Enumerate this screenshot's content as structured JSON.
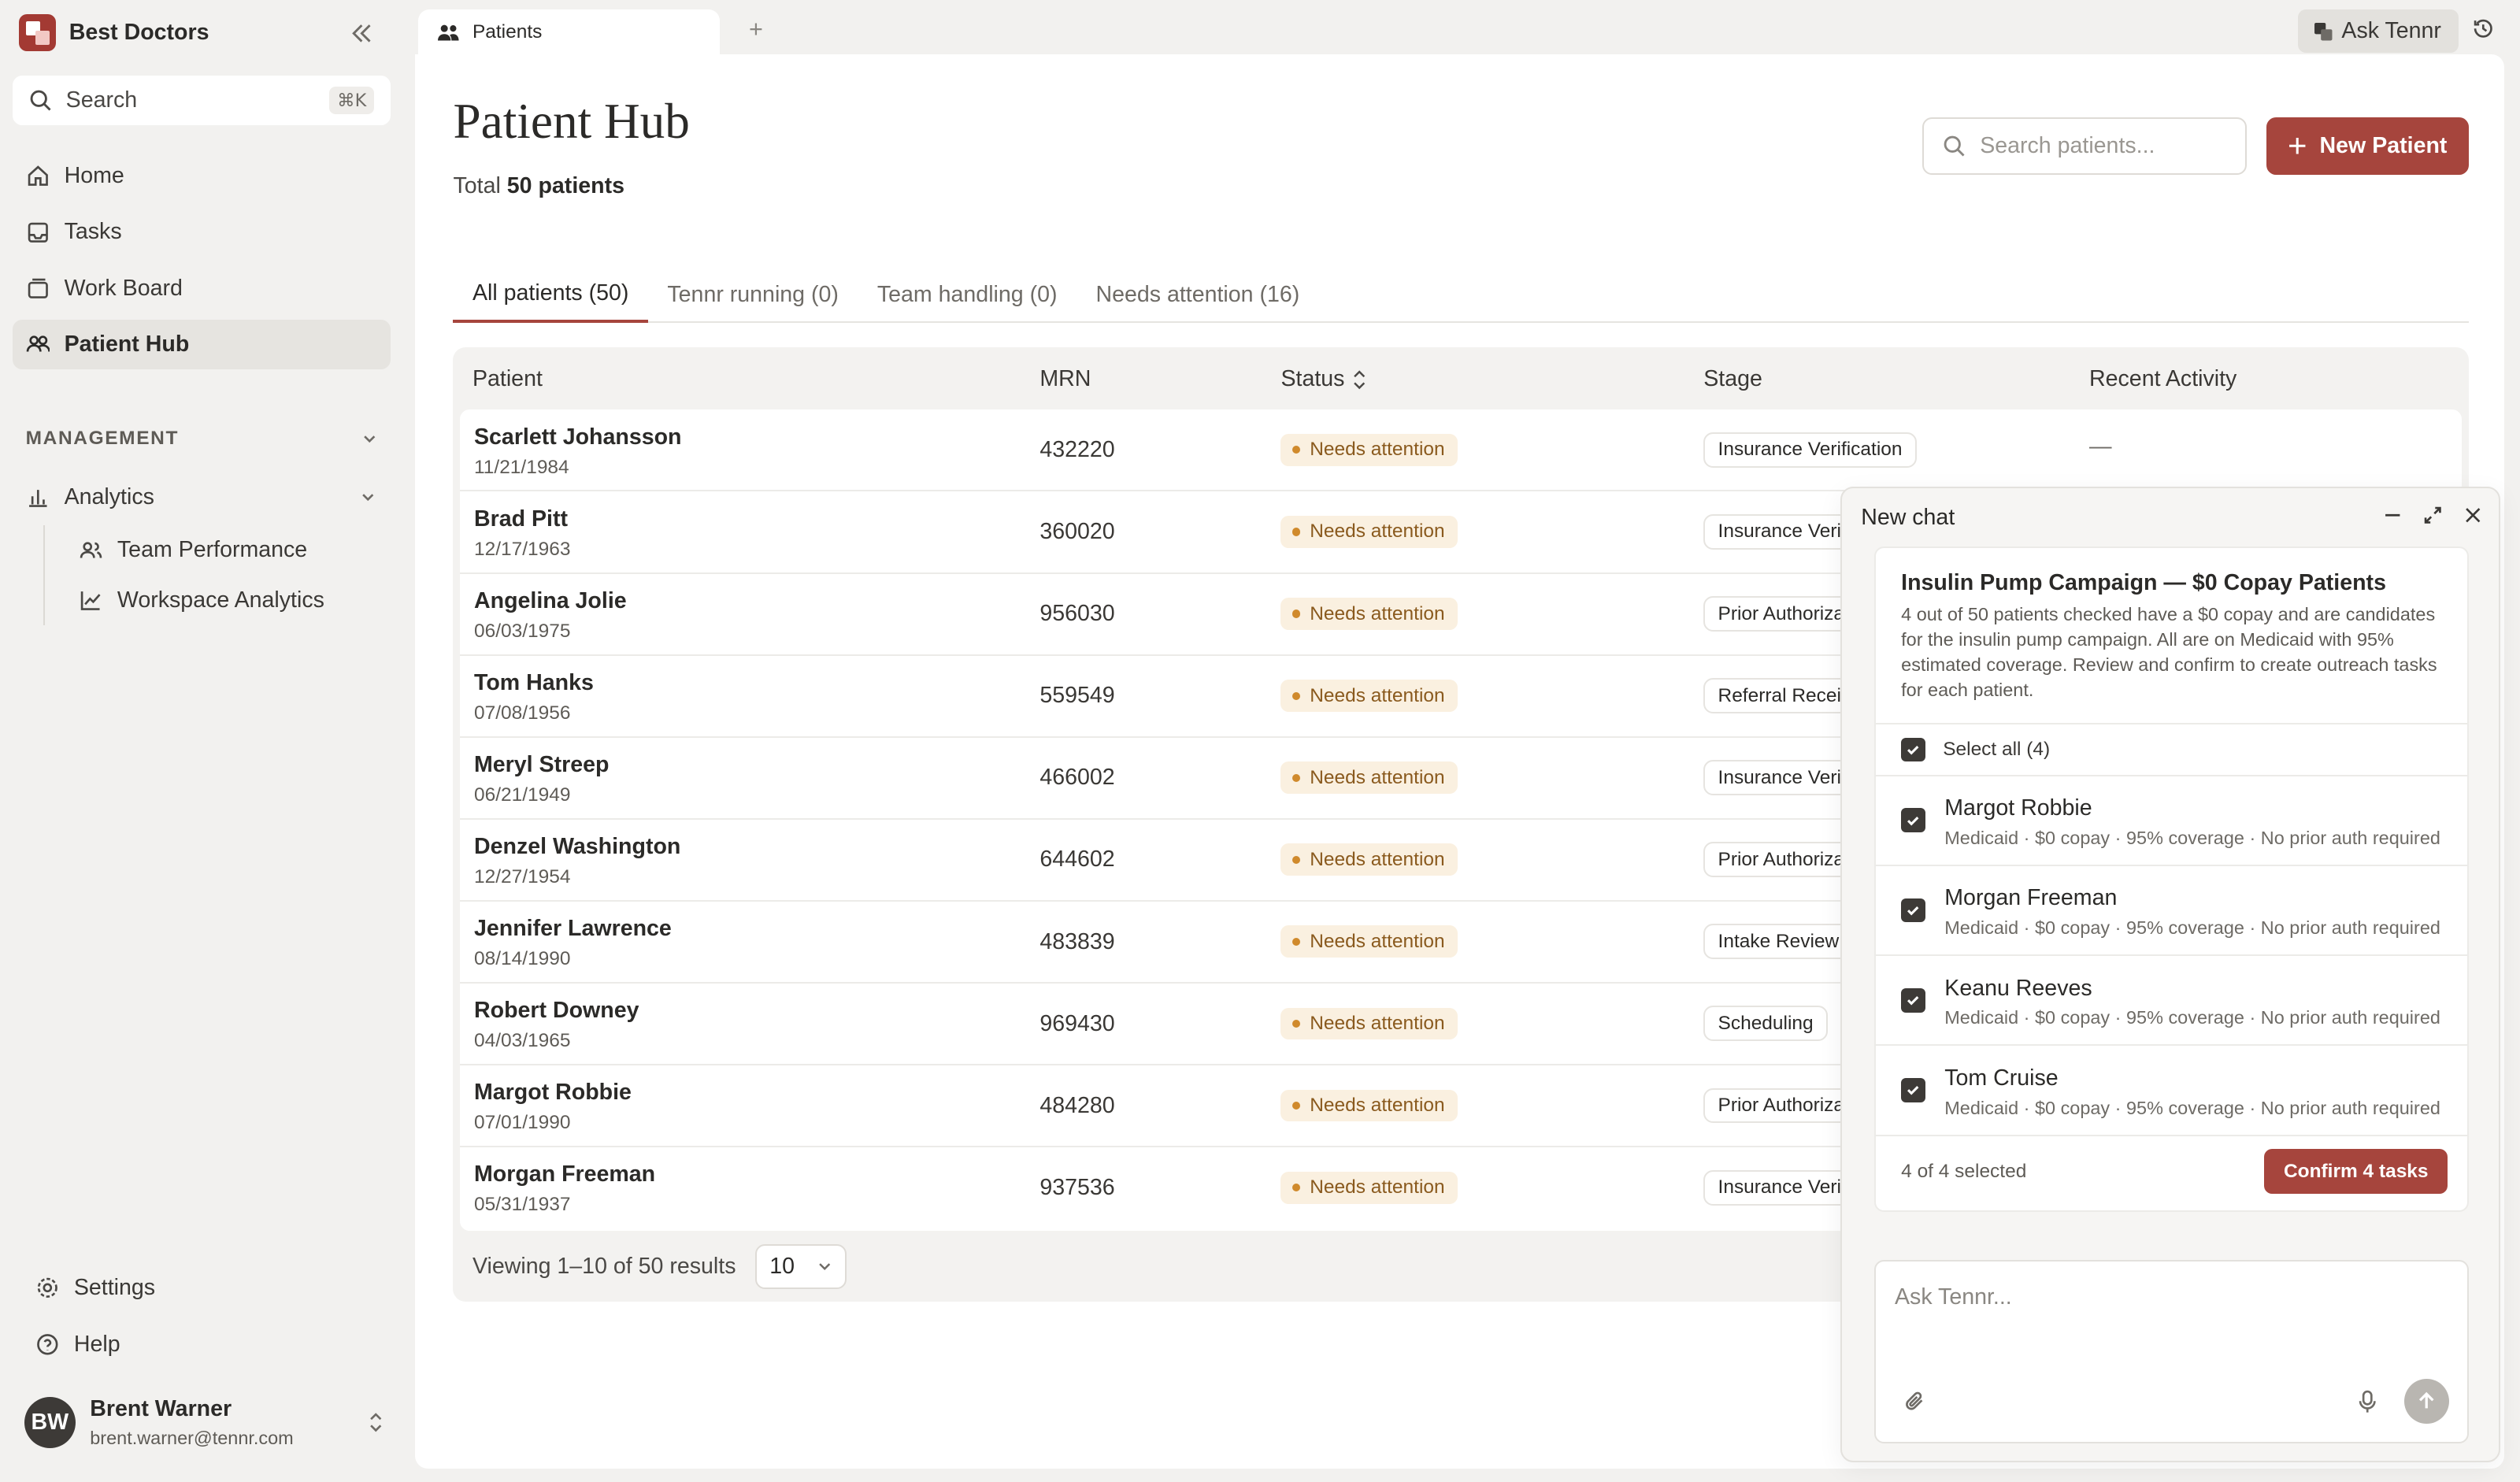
{
  "sidebar": {
    "brand_name": "Best Doctors",
    "search_label": "Search",
    "search_shortcut": "⌘K",
    "nav": [
      {
        "label": "Home"
      },
      {
        "label": "Tasks"
      },
      {
        "label": "Work Board"
      },
      {
        "label": "Patient Hub"
      }
    ],
    "section_label": "MANAGEMENT",
    "analytics_label": "Analytics",
    "analytics_items": [
      {
        "label": "Team Performance"
      },
      {
        "label": "Workspace Analytics"
      }
    ],
    "settings_label": "Settings",
    "help_label": "Help",
    "user": {
      "initials": "BW",
      "name": "Brent Warner",
      "email": "brent.warner@tennr.com"
    }
  },
  "topbar": {
    "tab_label": "Patients",
    "new_tab": "+",
    "ask_label": "Ask Tennr"
  },
  "main": {
    "title": "Patient Hub",
    "total_prefix": "Total",
    "total_value": "50 patients",
    "search_placeholder": "Search patients...",
    "new_patient_label": "New Patient",
    "tabs": [
      {
        "label": "All patients (50)"
      },
      {
        "label": "Tennr running (0)"
      },
      {
        "label": "Team handling (0)"
      },
      {
        "label": "Needs attention (16)"
      }
    ],
    "columns": {
      "patient": "Patient",
      "mrn": "MRN",
      "status": "Status",
      "stage": "Stage",
      "recent": "Recent Activity"
    },
    "rows": [
      {
        "name": "Scarlett Johansson",
        "dob": "11/21/1984",
        "mrn": "432220",
        "status": "Needs attention",
        "stage": "Insurance Verification",
        "recent": "—"
      },
      {
        "name": "Brad Pitt",
        "dob": "12/17/1963",
        "mrn": "360020",
        "status": "Needs attention",
        "stage": "Insurance Verification",
        "recent": ""
      },
      {
        "name": "Angelina Jolie",
        "dob": "06/03/1975",
        "mrn": "956030",
        "status": "Needs attention",
        "stage": "Prior Authorization",
        "recent": ""
      },
      {
        "name": "Tom Hanks",
        "dob": "07/08/1956",
        "mrn": "559549",
        "status": "Needs attention",
        "stage": "Referral Received",
        "recent": ""
      },
      {
        "name": "Meryl Streep",
        "dob": "06/21/1949",
        "mrn": "466002",
        "status": "Needs attention",
        "stage": "Insurance Verification",
        "recent": ""
      },
      {
        "name": "Denzel Washington",
        "dob": "12/27/1954",
        "mrn": "644602",
        "status": "Needs attention",
        "stage": "Prior Authorization",
        "recent": ""
      },
      {
        "name": "Jennifer Lawrence",
        "dob": "08/14/1990",
        "mrn": "483839",
        "status": "Needs attention",
        "stage": "Intake Review",
        "recent": ""
      },
      {
        "name": "Robert Downey",
        "dob": "04/03/1965",
        "mrn": "969430",
        "status": "Needs attention",
        "stage": "Scheduling",
        "recent": ""
      },
      {
        "name": "Margot Robbie",
        "dob": "07/01/1990",
        "mrn": "484280",
        "status": "Needs attention",
        "stage": "Prior Authorization",
        "recent": ""
      },
      {
        "name": "Morgan Freeman",
        "dob": "05/31/1937",
        "mrn": "937536",
        "status": "Needs attention",
        "stage": "Insurance Verification",
        "recent": ""
      }
    ],
    "pagination_text": "Viewing 1–10 of 50 results",
    "page_size": "10"
  },
  "chat": {
    "title": "New chat",
    "card_title": "Insulin Pump Campaign — $0 Copay Patients",
    "card_desc": "4 out of 50 patients checked have a $0 copay and are candidates for the insulin pump campaign. All are on Medicaid with 95% estimated coverage. Review and confirm to create outreach tasks for each patient.",
    "select_all_label": "Select all (4)",
    "patients": [
      {
        "name": "Margot Robbie",
        "meta": "Medicaid · $0 copay · 95% coverage · No prior auth required"
      },
      {
        "name": "Morgan Freeman",
        "meta": "Medicaid · $0 copay · 95% coverage · No prior auth required"
      },
      {
        "name": "Keanu Reeves",
        "meta": "Medicaid · $0 copay · 95% coverage · No prior auth required"
      },
      {
        "name": "Tom Cruise",
        "meta": "Medicaid · $0 copay · 95% coverage · No prior auth required"
      }
    ],
    "selected_text": "4 of 4 selected",
    "confirm_label": "Confirm 4 tasks",
    "composer_placeholder": "Ask Tennr..."
  },
  "colors": {
    "accent": "#a6453d",
    "status_bg": "#faf0e0",
    "status_text": "#8a5a1e"
  }
}
